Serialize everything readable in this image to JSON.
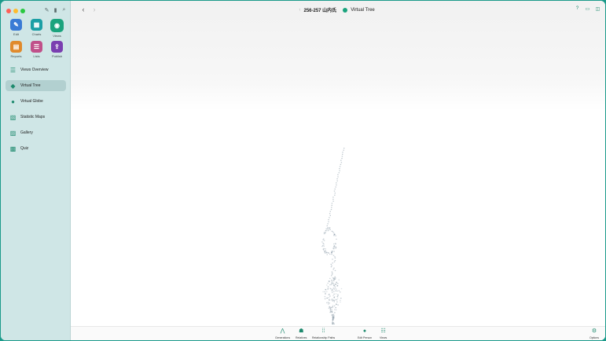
{
  "sidebar": {
    "modules": [
      {
        "label": "Edit",
        "icon": "pencil-icon",
        "color": "#3a7bd5",
        "glyph": "✎"
      },
      {
        "label": "Charts",
        "icon": "charts-icon",
        "color": "#1a9fa5",
        "glyph": "▦"
      },
      {
        "label": "Views",
        "icon": "eye-icon",
        "color": "#1aa37d",
        "glyph": "◉"
      },
      {
        "label": "Reports",
        "icon": "reports-icon",
        "color": "#e08a2c",
        "glyph": "▤"
      },
      {
        "label": "Lists",
        "icon": "lists-icon",
        "color": "#c0508a",
        "glyph": "☰"
      },
      {
        "label": "Publish",
        "icon": "publish-icon",
        "color": "#7a3fb0",
        "glyph": "⇪"
      }
    ],
    "nav": [
      {
        "label": "Views Overview",
        "icon": "list-icon",
        "glyph": "☰"
      },
      {
        "label": "Virtual Tree",
        "icon": "cube-icon",
        "glyph": "◆"
      },
      {
        "label": "Virtual Globe",
        "icon": "globe-icon",
        "glyph": "●"
      },
      {
        "label": "Statistic Maps",
        "icon": "map-icon",
        "glyph": "▧"
      },
      {
        "label": "Gallery",
        "icon": "image-icon",
        "glyph": "▨"
      },
      {
        "label": "Quiz",
        "icon": "quiz-icon",
        "glyph": "▩"
      }
    ],
    "selected_nav": "Virtual Tree"
  },
  "toolbar": {
    "family": "256-257 山内氏",
    "view_title": "Virtual Tree"
  },
  "bottom_bar": [
    {
      "label": "Generations",
      "icon": "generations-icon",
      "glyph": "⋀"
    },
    {
      "label": "Relatives",
      "icon": "relatives-icon",
      "glyph": "☗"
    },
    {
      "label": "Relationship Paths",
      "icon": "paths-icon",
      "glyph": "⁞⁞"
    },
    {
      "label": "Edit Person",
      "icon": "edit-person-icon",
      "glyph": "●"
    },
    {
      "label": "Views",
      "icon": "views-icon",
      "glyph": "☷"
    },
    {
      "label": "Options",
      "icon": "options-icon",
      "glyph": "⚙"
    }
  ],
  "colors": {
    "accent": "#1aa37d",
    "sidebar_bg": "#cfe6e6",
    "selected_bg": "#b2d0d0"
  }
}
